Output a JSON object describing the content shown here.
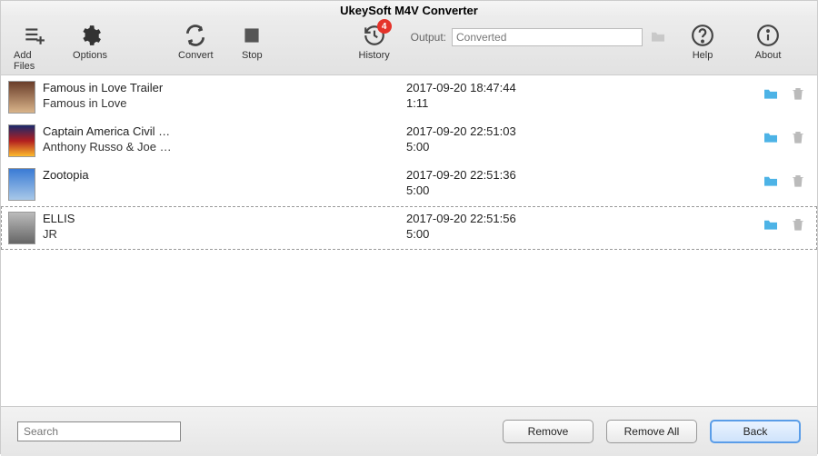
{
  "app": {
    "title": "UkeySoft M4V Converter"
  },
  "toolbar": {
    "addFiles": "Add Files",
    "options": "Options",
    "convert": "Convert",
    "stop": "Stop",
    "history": "History",
    "historyBadge": "4",
    "outputLabel": "Output:",
    "outputValue": "Converted",
    "help": "Help",
    "about": "About"
  },
  "rows": [
    {
      "title": "Famous in Love  Trailer",
      "subtitle": "Famous in Love",
      "date": "2017-09-20 18:47:44",
      "duration": "1:11"
    },
    {
      "title": "Captain America  Civil …",
      "subtitle": "Anthony Russo & Joe …",
      "date": "2017-09-20 22:51:03",
      "duration": "5:00"
    },
    {
      "title": "Zootopia",
      "subtitle": "",
      "date": "2017-09-20 22:51:36",
      "duration": "5:00"
    },
    {
      "title": "ELLIS",
      "subtitle": "JR",
      "date": "2017-09-20 22:51:56",
      "duration": "5:00"
    }
  ],
  "footer": {
    "searchPlaceholder": "Search",
    "remove": "Remove",
    "removeAll": "Remove All",
    "back": "Back"
  }
}
